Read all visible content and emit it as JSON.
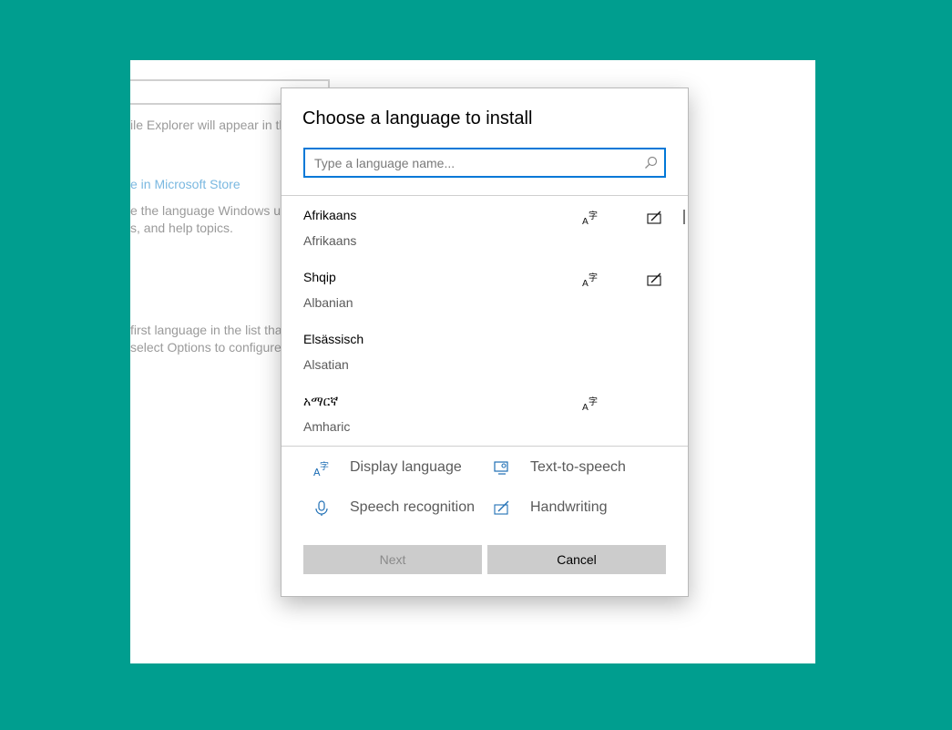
{
  "background": {
    "lines": [
      "ile Explorer will appear in th",
      "e the language Windows us",
      "s, and help topics.",
      "first language in the list tha",
      "select Options to configure"
    ],
    "store_link": "e in Microsoft Store"
  },
  "dialog": {
    "title": "Choose a language to install",
    "search_placeholder": "Type a language name...",
    "search_value": "",
    "languages": [
      {
        "native": "Afrikaans",
        "english": "Afrikaans",
        "features": [
          "display-language",
          "handwriting"
        ]
      },
      {
        "native": "Shqip",
        "english": "Albanian",
        "features": [
          "display-language",
          "handwriting"
        ]
      },
      {
        "native": "Elsässisch",
        "english": "Alsatian",
        "features": []
      },
      {
        "native": "አማርኛ",
        "english": "Amharic",
        "features": [
          "display-language"
        ]
      }
    ],
    "legend": {
      "display_language": "Display language",
      "text_to_speech": "Text-to-speech",
      "speech_recognition": "Speech recognition",
      "handwriting": "Handwriting"
    },
    "next_label": "Next",
    "cancel_label": "Cancel"
  },
  "colors": {
    "desktop": "#009e8f",
    "accent": "#0078d7",
    "icon_blue": "#1f6fb5",
    "button_disabled": "#cccccc"
  }
}
